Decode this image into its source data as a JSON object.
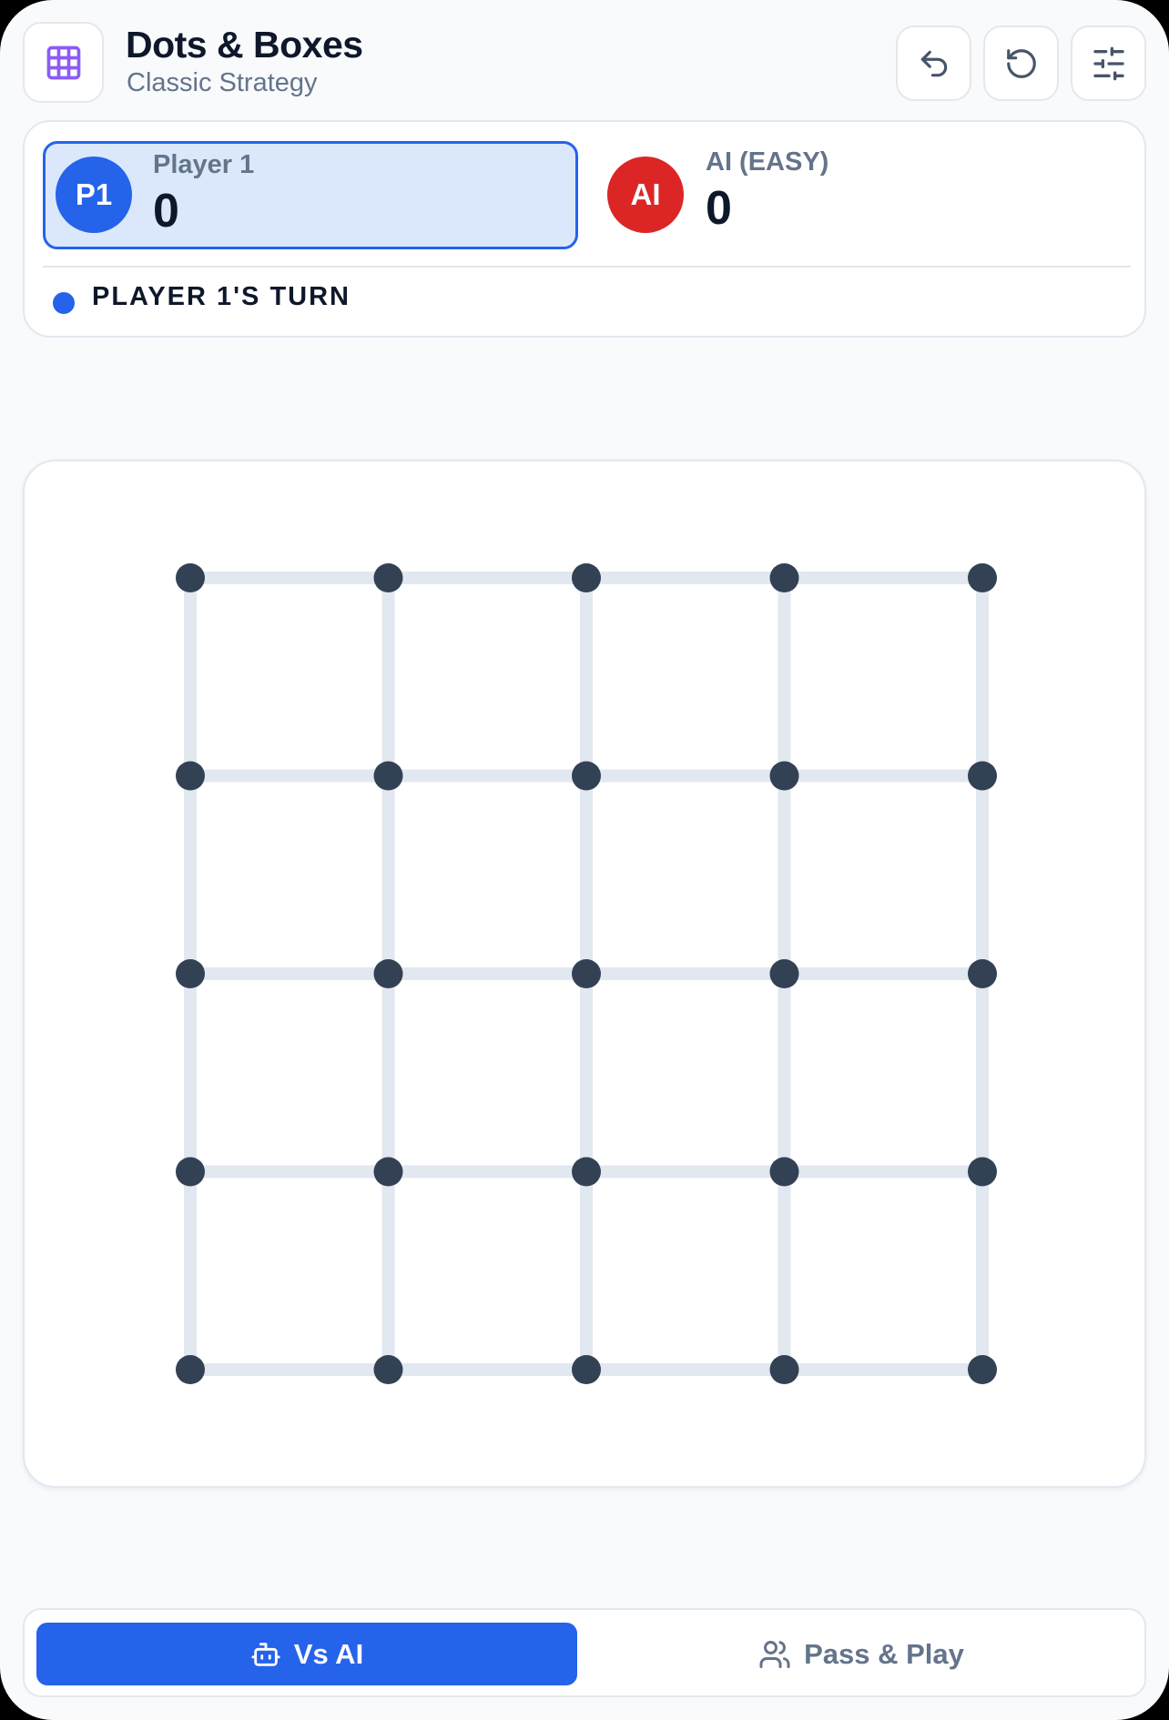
{
  "header": {
    "title": "Dots & Boxes",
    "subtitle": "Classic Strategy",
    "logo_icon": "grid-icon",
    "actions": [
      {
        "name": "undo-button",
        "icon": "undo-icon"
      },
      {
        "name": "restart-button",
        "icon": "restart-icon"
      },
      {
        "name": "settings-button",
        "icon": "sliders-icon"
      }
    ]
  },
  "scoreboard": {
    "player1": {
      "avatar": "P1",
      "name": "Player 1",
      "score": "0",
      "color": "#2563eb",
      "active": true
    },
    "player2": {
      "avatar": "AI",
      "name": "AI (EASY)",
      "score": "0",
      "color": "#dc2626",
      "active": false
    },
    "turn_label": "PLAYER 1'S TURN",
    "turn_color": "#2563eb"
  },
  "board": {
    "dots_per_side": 5,
    "boxes_per_side": 4,
    "drawn_lines": [],
    "claimed_boxes": [],
    "dot_color": "#334155",
    "line_color": "#e2e8f0"
  },
  "modes": {
    "vs_ai_label": "Vs AI",
    "pass_play_label": "Pass & Play",
    "selected": "Vs AI"
  }
}
